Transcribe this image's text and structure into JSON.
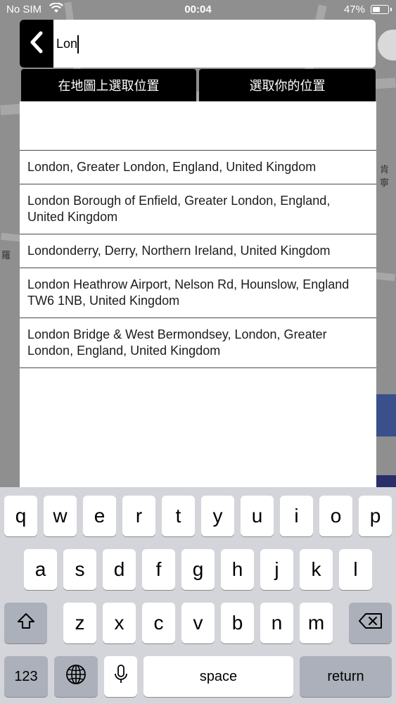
{
  "status_bar": {
    "carrier": "No SIM",
    "time": "00:04",
    "battery_percent": "47%",
    "battery_level": 0.47
  },
  "map": {
    "label_right": "肯 寧",
    "label_left": "羅"
  },
  "search": {
    "value": "Lon",
    "back_icon": "chevron-left-icon"
  },
  "options": {
    "pick_on_map": "在地圖上選取位置",
    "pick_my_location": "選取你的位置"
  },
  "results": [
    {
      "text": "London, Greater London, England, United Kingdom"
    },
    {
      "text": "London Borough of Enfield, Greater London, England, United Kingdom"
    },
    {
      "text": "Londonderry, Derry, Northern Ireland, United Kingdom"
    },
    {
      "text": "London Heathrow Airport, Nelson Rd, Hounslow, England TW6 1NB, United Kingdom"
    },
    {
      "text": "London Bridge & West Bermondsey, London, Greater London, England, United Kingdom"
    }
  ],
  "keyboard": {
    "row1": [
      "q",
      "w",
      "e",
      "r",
      "t",
      "y",
      "u",
      "i",
      "o",
      "p"
    ],
    "row2": [
      "a",
      "s",
      "d",
      "f",
      "g",
      "h",
      "j",
      "k",
      "l"
    ],
    "row3": [
      "z",
      "x",
      "c",
      "v",
      "b",
      "n",
      "m"
    ],
    "numbers_label": "123",
    "space_label": "space",
    "return_label": "return"
  }
}
